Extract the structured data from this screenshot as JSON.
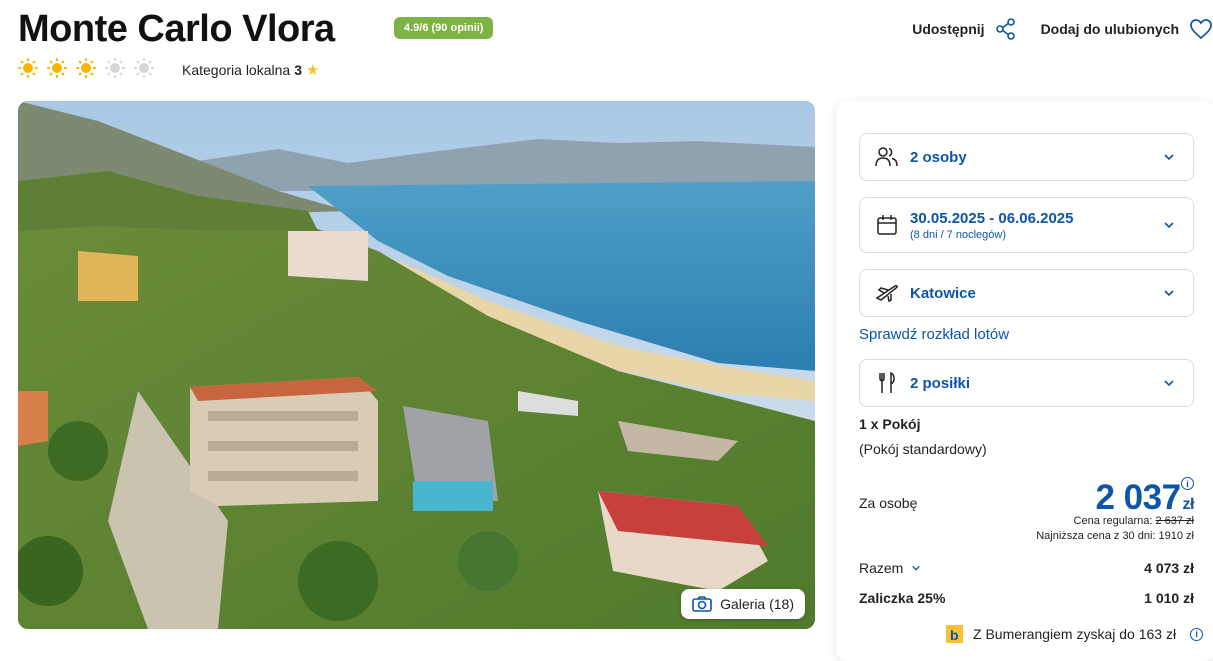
{
  "hotel": {
    "name": "Monte Carlo Vlora",
    "rating_badge": "4.9/6 (90 opinii)",
    "suns_total": 5,
    "suns_filled": 3,
    "category_label": "Kategoria lokalna",
    "category_value": "3"
  },
  "actions": {
    "share": "Udostępnij",
    "favorite": "Dodaj do ulubionych"
  },
  "gallery": {
    "label": "Galeria (18)"
  },
  "booking": {
    "persons": "2 osoby",
    "dates": "30.05.2025 - 06.06.2025",
    "dates_sub": "(8 dni / 7 noclegów)",
    "departure": "Katowice",
    "flight_link": "Sprawdź rozkład lotów",
    "meals": "2 posiłki",
    "room_count": "1 x Pokój",
    "room_type": "(Pokój standardowy)",
    "per_person_label": "Za osobę",
    "price": "2 037",
    "currency": "zł",
    "regular_label": "Cena regularna:",
    "regular_price": "2 637 zł",
    "lowest_label": "Najniższa cena z 30 dni: 1910 zł",
    "total_label": "Razem",
    "total_value": "4 073 zł",
    "deposit_label": "Zaliczka 25%",
    "deposit_value": "1 010 zł",
    "boomerang": "Z Bumerangiem zyskaj do 163 zł"
  },
  "colors": {
    "accent": "#0d55a8",
    "rating_green": "#7cb342",
    "sun_on": "#f7b500",
    "sun_off": "#d6d6d6"
  }
}
